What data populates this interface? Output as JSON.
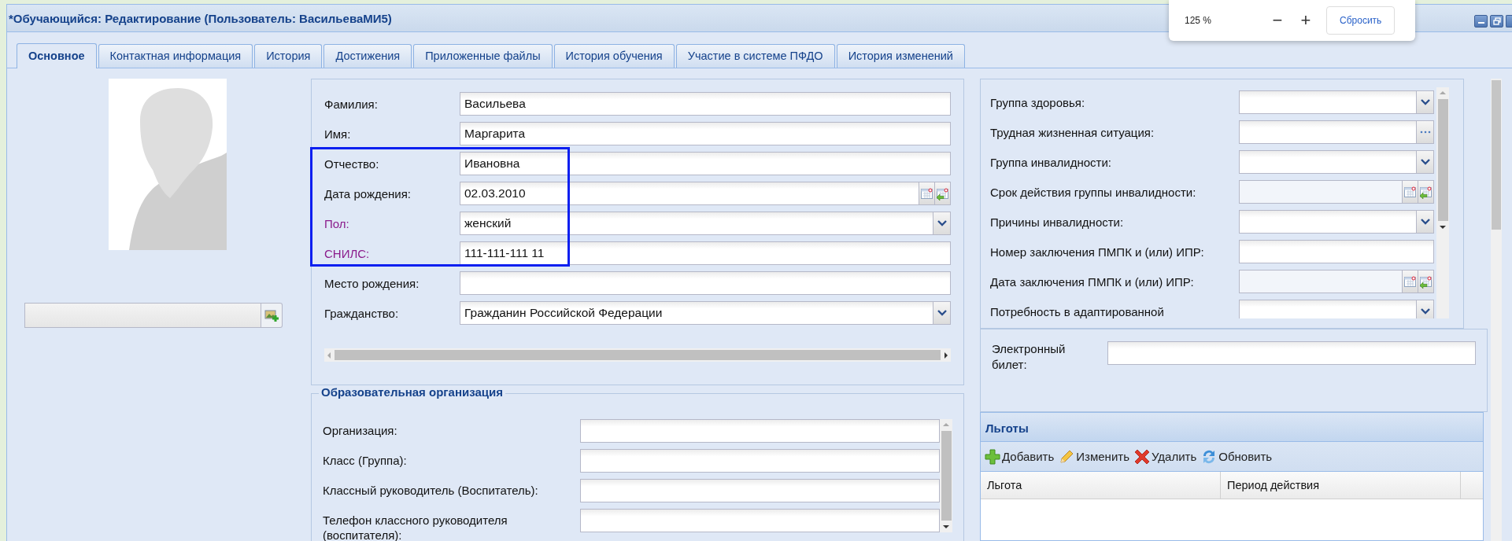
{
  "window": {
    "title": "*Обучающийся: Редактирование (Пользователь: ВасильеваМИ5)"
  },
  "zoom_popup": {
    "zoom": "125 %",
    "zoom_out": "−",
    "zoom_in": "+",
    "reset": "Сбросить"
  },
  "tabs": [
    {
      "label": "Основное",
      "selected": true
    },
    {
      "label": "Контактная информация",
      "selected": false
    },
    {
      "label": "История",
      "selected": false
    },
    {
      "label": "Достижения",
      "selected": false
    },
    {
      "label": "Приложенные файлы",
      "selected": false
    },
    {
      "label": "История обучения",
      "selected": false
    },
    {
      "label": "Участие в системе ПФДО",
      "selected": false
    },
    {
      "label": "История изменений",
      "selected": false
    }
  ],
  "personal": {
    "fields": [
      {
        "label": "Фамилия:",
        "kind": "text",
        "value": "Васильева",
        "required": false,
        "highlighted": false
      },
      {
        "label": "Имя:",
        "kind": "text",
        "value": "Маргарита",
        "required": false,
        "highlighted": false
      },
      {
        "label": "Отчество:",
        "kind": "text",
        "value": "Ивановна",
        "required": false,
        "highlighted": true
      },
      {
        "label": "Дата рождения:",
        "kind": "date",
        "value": "02.03.2010",
        "required": false,
        "highlighted": true
      },
      {
        "label": "Пол:",
        "kind": "combo",
        "value": "женский",
        "required": true,
        "highlighted": true
      },
      {
        "label": "СНИЛС:",
        "kind": "text",
        "value": "111-111-111 11",
        "required": true,
        "highlighted": true
      },
      {
        "label": "Место рождения:",
        "kind": "text",
        "required": false,
        "highlighted": false
      },
      {
        "label": "Гражданство:",
        "kind": "combo",
        "value": "Гражданин Российской Федерации",
        "required": false,
        "highlighted": false
      }
    ]
  },
  "education": {
    "title": "Образовательная организация",
    "fields": [
      {
        "label": "Организация:"
      },
      {
        "label": "Класс (Группа):"
      },
      {
        "label": "Классный руководитель (Воспитатель):"
      },
      {
        "label": "Телефон классного руководителя (воспитателя):"
      }
    ]
  },
  "health": {
    "fields": [
      {
        "label": "Группа здоровья:",
        "kind": "combo",
        "disabled": false
      },
      {
        "label": "Трудная жизненная ситуация:",
        "kind": "picker",
        "disabled": false
      },
      {
        "label": "Группа инвалидности:",
        "kind": "combo",
        "disabled": false
      },
      {
        "label": "Срок действия группы инвалидности:",
        "kind": "date",
        "disabled": true
      },
      {
        "label": "Причины инвалидности:",
        "kind": "combo",
        "disabled": false
      },
      {
        "label": "Номер заключения ПМПК и (или) ИПР:",
        "kind": "text",
        "disabled": false
      },
      {
        "label": "Дата заключения ПМПК и (или) ИПР:",
        "kind": "date",
        "disabled": true
      },
      {
        "label": "Потребность в адаптированной",
        "kind": "combo",
        "disabled": false
      }
    ]
  },
  "ticket": {
    "label": "Электронный билет:"
  },
  "benefits": {
    "title": "Льготы",
    "actions": [
      {
        "label": "Добавить",
        "kind": "add"
      },
      {
        "label": "Изменить",
        "kind": "edit"
      },
      {
        "label": "Удалить",
        "kind": "delete"
      },
      {
        "label": "Обновить",
        "kind": "refresh"
      }
    ],
    "columns": [
      "Льгота",
      "Период действия"
    ]
  }
}
